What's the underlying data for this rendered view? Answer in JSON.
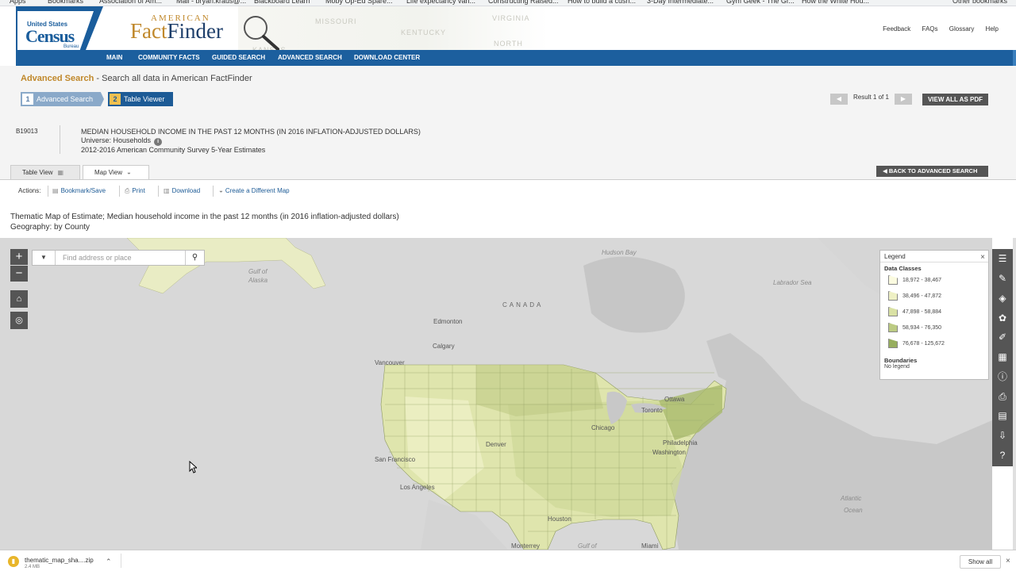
{
  "browser": {
    "bookmarks": [
      "Apps",
      "Bookmarks",
      "Association of Am...",
      "Mail - bryan.kraus@...",
      "Blackboard Learn",
      "Moby Op-Ed Spare...",
      "Life expectancy van...",
      "Constructing Raised...",
      "How to build a cush...",
      "3-Day Intermediate...",
      "Gym Geek - The Gr...",
      "How the White Hou...",
      "Other bookmarks"
    ]
  },
  "header": {
    "logo_line1": "United States",
    "logo_line2": "Census",
    "logo_line3": "Bureau",
    "product_small": "AMERICAN",
    "product_a": "Fact",
    "product_b": "Finder",
    "map_states": [
      "MISSOURI",
      "KENTUCKY",
      "VIRGINIA",
      "NORTH",
      "KANSAS"
    ],
    "links": [
      "Feedback",
      "FAQs",
      "Glossary",
      "Help"
    ]
  },
  "nav": {
    "items": [
      "MAIN",
      "COMMUNITY FACTS",
      "GUIDED SEARCH",
      "ADVANCED SEARCH",
      "DOWNLOAD CENTER"
    ]
  },
  "page": {
    "title_accent": "Advanced Search",
    "title_rest": " - Search all data in American FactFinder",
    "step1_num": "1",
    "step1_label": "Advanced Search",
    "step2_num": "2",
    "step2_label": "Table Viewer",
    "pager_prev": "◀",
    "pager_text": "Result 1 of 1",
    "pager_next": "▶",
    "view_pdf": "VIEW ALL AS PDF"
  },
  "table": {
    "id": "B19013",
    "title": "MEDIAN HOUSEHOLD INCOME IN THE PAST 12 MONTHS (IN 2016 INFLATION-ADJUSTED DOLLARS)",
    "universe": "Universe:  Households",
    "info": "i",
    "survey": "2012-2016 American Community Survey 5-Year Estimates"
  },
  "tabs": {
    "table_view": "Table View",
    "map_view": "Map View",
    "back": "BACK TO ADVANCED SEARCH"
  },
  "actions": {
    "label": "Actions:",
    "bookmark": "Bookmark/Save",
    "print": "Print",
    "download": "Download",
    "create_map": "Create a Different Map"
  },
  "map_title": {
    "line1": "Thematic Map of Estimate; Median household income in the past 12 months (in 2016 inflation-adjusted dollars)",
    "line2": "Geography: by County"
  },
  "map": {
    "zoom_in": "+",
    "zoom_out": "−",
    "search_placeholder": "Find address or place",
    "labels": {
      "hudson_bay": "Hudson Bay",
      "gulf_alaska_1": "Gulf of",
      "gulf_alaska_2": "Alaska",
      "labrador_sea": "Labrador Sea",
      "canada": "CANADA",
      "edmonton": "Edmonton",
      "calgary": "Calgary",
      "vancouver": "Vancouver",
      "ottawa": "Ottawa",
      "toronto": "Toronto",
      "chicago": "Chicago",
      "denver": "Denver",
      "philadelphia": "Philadelphia",
      "washington": "Washington",
      "san_francisco": "San Francisco",
      "los_angeles": "Los Angeles",
      "houston": "Houston",
      "monterrey": "Monterrey",
      "gulf_mexico": "Gulf of",
      "miami": "Miami",
      "atlantic_1": "Atlantic",
      "atlantic_2": "Ocean"
    }
  },
  "legend": {
    "title": "Legend",
    "close": "×",
    "data_classes_label": "Data Classes",
    "classes": [
      {
        "label": "18,972 - 38,467",
        "color": "#fbfbe0"
      },
      {
        "label": "38,496 - 47,872",
        "color": "#eef0c4"
      },
      {
        "label": "47,898 - 58,884",
        "color": "#d9e1a4"
      },
      {
        "label": "58,934 - 76,350",
        "color": "#bccb83"
      },
      {
        "label": "76,678 - 125,672",
        "color": "#97ae5f"
      }
    ],
    "boundaries_label": "Boundaries",
    "boundaries_value": "No legend"
  },
  "download": {
    "file": "thematic_map_sha....zip",
    "size": "2.4 MB",
    "show_all": "Show all",
    "close": "×"
  }
}
